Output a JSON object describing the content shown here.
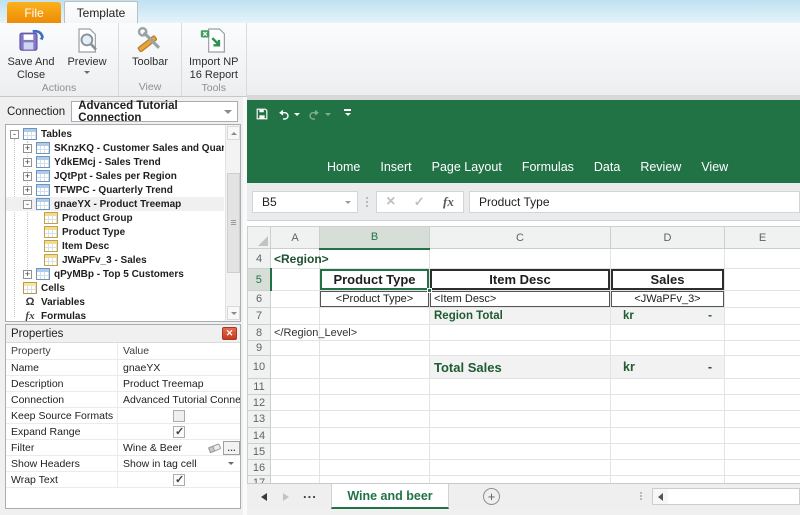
{
  "colors": {
    "excel_green": "#217346",
    "tag_green": "#1F5132",
    "total_green": "#1E5B31",
    "file_tab_orange": "#F2A11F",
    "accent_fill_gray": "#F2F2F2"
  },
  "ribbon": {
    "tabs": {
      "file": "File",
      "template": "Template"
    },
    "groups": {
      "actions": {
        "label": "Actions",
        "save_line1": "Save And",
        "save_line2": "Close",
        "preview_label": "Preview"
      },
      "view": {
        "label": "View",
        "toolbar_label": "Toolbar"
      },
      "tools": {
        "label": "Tools",
        "import_line1": "Import NP",
        "import_line2": "16 Report"
      }
    }
  },
  "connection": {
    "label": "Connection",
    "value": "Advanced Tutorial Connection"
  },
  "tree": {
    "items": [
      {
        "label": "Tables",
        "icon": "table",
        "expander": "minus",
        "depth": 0
      },
      {
        "label": "SKnzKQ - Customer Sales and Quantity",
        "icon": "table",
        "expander": "plus",
        "depth": 1
      },
      {
        "label": "YdkEMcj - Sales Trend",
        "icon": "table",
        "expander": "plus",
        "depth": 1
      },
      {
        "label": "JQtPpt - Sales per Region",
        "icon": "table",
        "expander": "plus",
        "depth": 1
      },
      {
        "label": "TFWPC - Quarterly Trend",
        "icon": "table",
        "expander": "plus",
        "depth": 1
      },
      {
        "label": "gnaeYX - Product Treemap",
        "icon": "table",
        "expander": "minus",
        "depth": 1
      },
      {
        "label": "Product Group",
        "icon": "field",
        "depth": 2
      },
      {
        "label": "Product Type",
        "icon": "field",
        "depth": 2
      },
      {
        "label": "Item Desc",
        "icon": "field",
        "depth": 2
      },
      {
        "label": "JWaPFv_3 - Sales",
        "icon": "field",
        "depth": 2
      },
      {
        "label": "qPyMBp - Top 5 Customers",
        "icon": "table",
        "expander": "plus",
        "depth": 1
      },
      {
        "label": "Cells",
        "icon": "cells",
        "depth": 0
      },
      {
        "label": "Variables",
        "icon": "omega",
        "depth": 0
      },
      {
        "label": "Formulas",
        "icon": "fx",
        "depth": 0
      }
    ]
  },
  "properties": {
    "title": "Properties",
    "col_property": "Property",
    "col_value": "Value",
    "rows": {
      "name": {
        "label": "Name",
        "value": "gnaeYX"
      },
      "description": {
        "label": "Description",
        "value": "Product Treemap"
      },
      "connection": {
        "label": "Connection",
        "value": "Advanced Tutorial Connecti"
      },
      "keep_source_formats": {
        "label": "Keep Source Formats",
        "checked": false
      },
      "expand_range": {
        "label": "Expand Range",
        "checked": true
      },
      "filter": {
        "label": "Filter",
        "value": "Wine & Beer"
      },
      "show_headers": {
        "label": "Show Headers",
        "value": "Show in tag cell"
      },
      "wrap_text": {
        "label": "Wrap Text",
        "checked": true
      }
    }
  },
  "excel": {
    "menu": [
      "Home",
      "Insert",
      "Page Layout",
      "Formulas",
      "Data",
      "Review",
      "View"
    ],
    "name_box": "B5",
    "formula_value": "Product Type",
    "grid": {
      "col_letters": [
        "A",
        "B",
        "C",
        "D",
        "E"
      ],
      "row_numbers": [
        "4",
        "5",
        "6",
        "7",
        "8",
        "9",
        "10",
        "11",
        "12",
        "13",
        "14",
        "15",
        "16",
        "17"
      ],
      "cells": {
        "a4": "<Region>",
        "b5": "Product Type",
        "c5": "Item Desc",
        "d5": "Sales",
        "b6": "<Product Type>",
        "c6": "<Item Desc>",
        "d6": "<JWaPFv_3>",
        "c7": "Region Total",
        "d7_currency": "kr",
        "d7_value": "-",
        "a8": "</Region_Level>",
        "c10": "Total Sales",
        "d10_currency": "kr",
        "d10_value": "-"
      }
    },
    "sheet_tabs": {
      "overflow": "...",
      "active": "Wine and beer"
    }
  }
}
